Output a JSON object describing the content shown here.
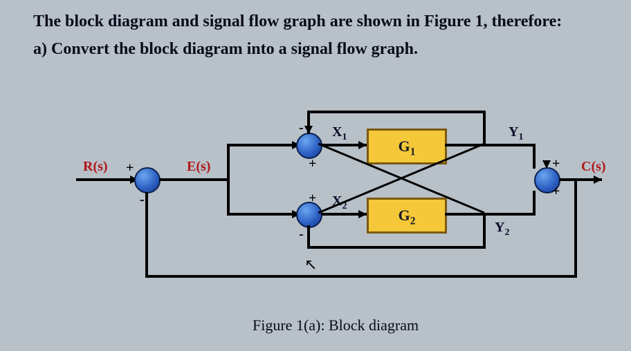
{
  "text": {
    "line1": "The block diagram and signal flow graph are shown in Figure 1, therefore:",
    "line2": "a) Convert the block diagram into a signal flow graph.",
    "caption": "Figure 1(a): Block diagram"
  },
  "signals": {
    "R": "R(s)",
    "E": "E(s)",
    "C": "C(s)",
    "X1": "X",
    "X1_sub": "1",
    "X2": "X",
    "X2_sub": "2",
    "Y1": "Y",
    "Y1_sub": "1",
    "Y2": "Y",
    "Y2_sub": "2"
  },
  "blocks": {
    "G1": "G",
    "G1_sub": "1",
    "G2": "G",
    "G2_sub": "2"
  },
  "signs": {
    "plus": "+",
    "minus": "-"
  },
  "diagram_structure": {
    "description": "Feedback control system block diagram",
    "input": "R(s)",
    "output": "C(s)",
    "summing_junctions": [
      {
        "id": "S1",
        "inputs": [
          "R(s) (+)",
          "C(s) feedback (-)"
        ],
        "output": "E(s)"
      },
      {
        "id": "S2_top",
        "inputs": [
          "E(s) (+)",
          "Y2 cross-feedback (-)"
        ],
        "output": "X1"
      },
      {
        "id": "S2_bot",
        "inputs": [
          "E(s) (+)",
          "Y1 cross-feedback (-)"
        ],
        "output": "X2"
      },
      {
        "id": "S3",
        "inputs": [
          "Y1 (+)",
          "Y2 (+)"
        ],
        "output": "C(s)"
      }
    ],
    "forward_blocks": [
      {
        "id": "G1",
        "from": "X1",
        "to": "Y1"
      },
      {
        "id": "G2",
        "from": "X2",
        "to": "Y2"
      }
    ],
    "feedback_paths": [
      {
        "from": "C(s)",
        "to": "S1",
        "sign": "-"
      },
      {
        "from": "Y1",
        "to": "S2_bot",
        "sign": "-",
        "type": "cross"
      },
      {
        "from": "Y2",
        "to": "S2_top",
        "sign": "-",
        "type": "cross"
      }
    ]
  }
}
